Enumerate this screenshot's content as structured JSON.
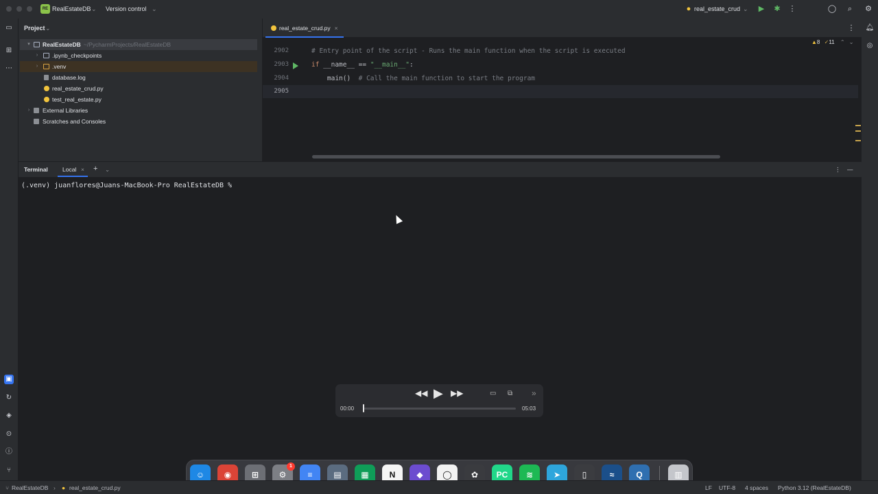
{
  "titlebar": {
    "project_badge": "RE",
    "project_name": "RealEstateDB",
    "vcs": "Version control",
    "run_config": "real_estate_crud"
  },
  "project_panel": {
    "title": "Project",
    "root_name": "RealEstateDB",
    "root_path": "~/PycharmProjects/RealEstateDB",
    "items": [
      {
        "label": ".ipynb_checkpoints"
      },
      {
        "label": ".venv"
      },
      {
        "label": "database.log"
      },
      {
        "label": "real_estate_crud.py"
      },
      {
        "label": "test_real_estate.py"
      },
      {
        "label": "External Libraries"
      },
      {
        "label": "Scratches and Consoles"
      }
    ]
  },
  "editor": {
    "tab_label": "real_estate_crud.py",
    "warnings": "8",
    "weak_warnings": "11",
    "lines": [
      {
        "num": "2902",
        "text": "# Entry point of the script - Runs the main function when the script is executed"
      },
      {
        "num": "2903",
        "kw": "if",
        "mid": " __name__ == ",
        "str": "\"__main__\"",
        "end": ":"
      },
      {
        "num": "2904",
        "code": "    main()",
        "comment": "  # Call the main function to start the program"
      },
      {
        "num": "2905"
      }
    ]
  },
  "terminal": {
    "title": "Terminal",
    "tab_label": "Local",
    "prompt": "(.venv) juanflores@Juans-MacBook-Pro RealEstateDB %"
  },
  "player": {
    "current_time": "00:00",
    "total_time": "05:03",
    "progress": 0.0
  },
  "dock": {
    "apps": [
      {
        "name": "Finder",
        "icon": "finder-icon",
        "color": "#1e88e5",
        "running": true
      },
      {
        "name": "Chrome",
        "icon": "chrome-icon",
        "color": "#db4437",
        "running": true
      },
      {
        "name": "Launchpad",
        "icon": "launchpad-icon",
        "color": "#6d6f75",
        "running": false
      },
      {
        "name": "System Settings",
        "icon": "settings-icon",
        "color": "#7d7f85",
        "running": false,
        "badge": "1"
      },
      {
        "name": "Docs",
        "icon": "docs-icon",
        "color": "#4285f4",
        "running": true
      },
      {
        "name": "Preview",
        "icon": "preview-icon",
        "color": "#5b6c80",
        "running": false
      },
      {
        "name": "Sheets",
        "icon": "sheets-icon",
        "color": "#0f9d58",
        "running": true
      },
      {
        "name": "Notion",
        "icon": "notion-icon",
        "color": "#f5f5f5",
        "running": true
      },
      {
        "name": "Obsidian",
        "icon": "obsidian-icon",
        "color": "#6c4ccf",
        "running": false
      },
      {
        "name": "Screen Recorder",
        "icon": "record-icon",
        "color": "#f2f2f2",
        "running": false
      },
      {
        "name": "ChatGPT",
        "icon": "chatgpt-icon",
        "color": "#3a3b3f",
        "running": true
      },
      {
        "name": "PyCharm",
        "icon": "pycharm-icon",
        "color": "#21d789",
        "running": true
      },
      {
        "name": "Spotify",
        "icon": "spotify-icon",
        "color": "#1db954",
        "running": true
      },
      {
        "name": "Telegram",
        "icon": "paper-plane-icon",
        "color": "#2ea6dc",
        "running": true
      },
      {
        "name": "Mouse Utility",
        "icon": "mouse-icon",
        "color": "#3b3c40",
        "running": false
      },
      {
        "name": "MySQL Workbench",
        "icon": "dolphin-icon",
        "color": "#1b4f8a",
        "running": true
      },
      {
        "name": "QuickTime Player",
        "icon": "quicktime-icon",
        "color": "#2f6fb0",
        "running": true
      },
      {
        "name": "Trash",
        "icon": "trash-icon",
        "color": "#c4c6cb",
        "running": false
      }
    ]
  },
  "statusbar": {
    "project": "RealEstateDB",
    "file": "real_estate_crud.py",
    "line_sep": "LF",
    "encoding": "UTF-8",
    "indent": "4 spaces",
    "interpreter": "Python 3.12 (RealEstateDB)"
  }
}
